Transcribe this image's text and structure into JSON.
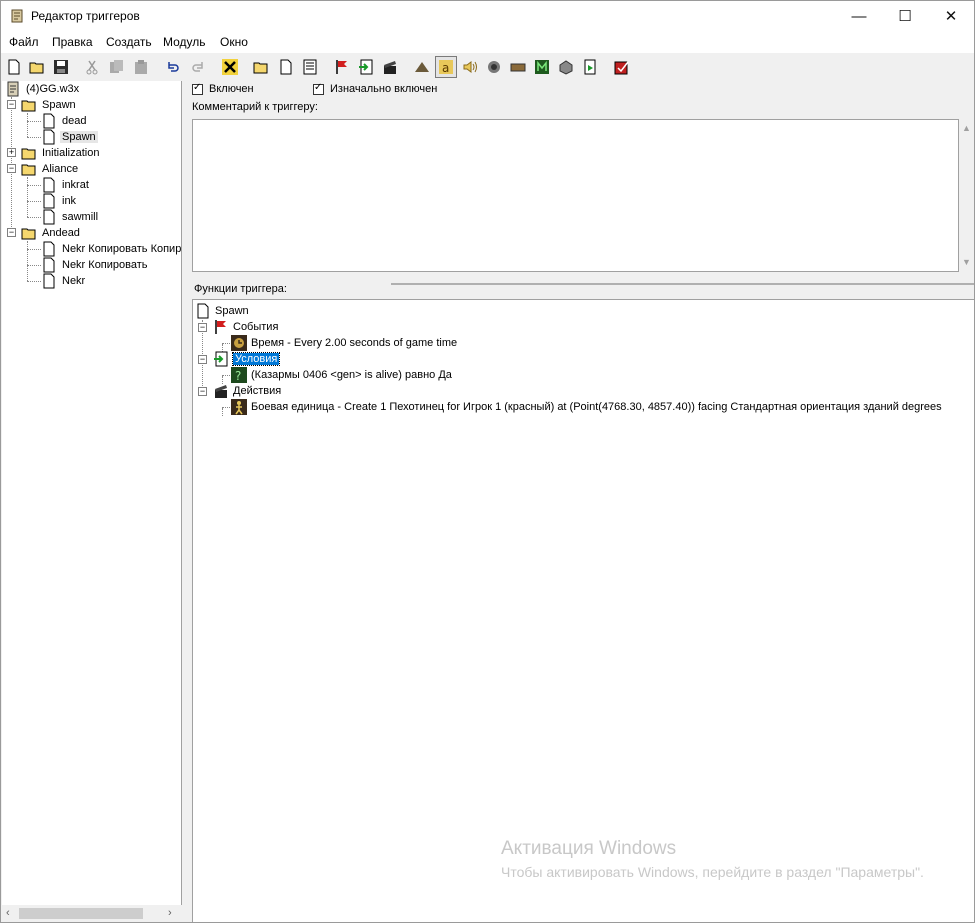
{
  "window": {
    "title": "Редактор триггеров",
    "controls": {
      "minimize": "—",
      "maximize": "☐",
      "close": "✕"
    }
  },
  "menu": [
    "Файл",
    "Правка",
    "Создать",
    "Модуль",
    "Окно"
  ],
  "toolbar": {
    "buttons": [
      "new-icon",
      "open-folder-icon",
      "save-icon",
      "cut-icon",
      "copy-icon",
      "paste-icon",
      "undo-icon",
      "redo-icon",
      "delete-icon",
      "new-category-icon",
      "new-trigger-icon",
      "new-comment-icon",
      "new-event-icon",
      "new-condition-icon",
      "new-action-icon",
      "terrain-icon",
      "unit-icon",
      "sound-icon",
      "object-icon",
      "camera-icon",
      "ai-icon",
      "import-icon",
      "test-map-icon",
      "quest-icon"
    ],
    "pressed": "unit-icon"
  },
  "tree": {
    "root": "(4)GG.w3x",
    "categories": [
      {
        "name": "Spawn",
        "expanded": true,
        "triggers": [
          "dead",
          "Spawn"
        ]
      },
      {
        "name": "Initialization",
        "expanded": false,
        "triggers": []
      },
      {
        "name": "Aliance",
        "expanded": true,
        "triggers": [
          "inkrat",
          "ink",
          "sawmill"
        ]
      },
      {
        "name": "Andead",
        "expanded": true,
        "triggers": [
          "Nekr Копировать Копир",
          "Nekr Копировать",
          "Nekr"
        ]
      }
    ],
    "selected": "Spawn"
  },
  "trigger": {
    "enabled_label": "Включен",
    "enabled": true,
    "initially_on_label": "Изначально включен",
    "initially_on": true,
    "comment_label": "Комментарий к триггеру:",
    "comment": "",
    "functions_label": "Функции триггера:"
  },
  "functions": {
    "name": "Spawn",
    "events_label": "События",
    "event": "Время - Every 2.00 seconds of game time",
    "conditions_label": "Условия",
    "condition": "(Казармы 0406 <gen> is alive) равно Да",
    "actions_label": "Действия",
    "action": "Боевая единица - Create 1 Пехотинец for Игрок 1 (красный) at (Point(4768.30, 4857.40)) facing Стандартная ориентация зданий degrees"
  },
  "watermark": {
    "line1": "Активация Windows",
    "line2": "Чтобы активировать Windows, перейдите в раздел \"Параметры\"."
  }
}
